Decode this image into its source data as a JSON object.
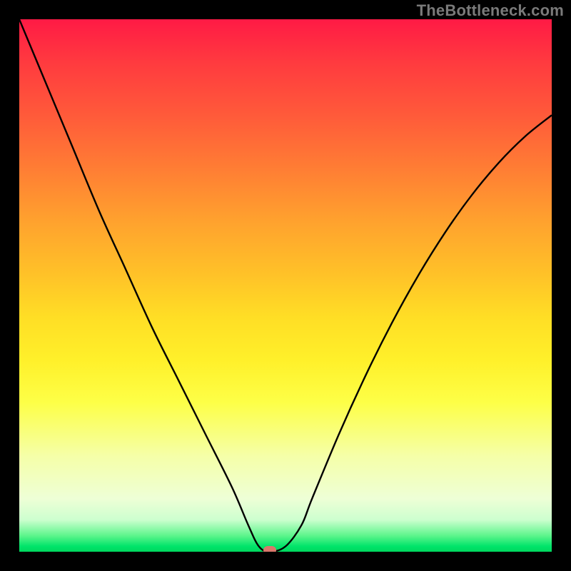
{
  "watermark": "TheBottleneck.com",
  "chart_data": {
    "type": "line",
    "title": "",
    "xlabel": "",
    "ylabel": "",
    "xlim": [
      0,
      100
    ],
    "ylim": [
      0,
      100
    ],
    "series": [
      {
        "name": "bottleneck-curve",
        "x": [
          0,
          5,
          10,
          15,
          20,
          25,
          30,
          35,
          40,
          43,
          45,
          47,
          50,
          53,
          55,
          60,
          65,
          70,
          75,
          80,
          85,
          90,
          95,
          100
        ],
        "values": [
          100,
          88,
          76,
          64,
          53,
          42,
          32,
          22,
          12,
          5,
          1,
          0,
          1,
          5,
          10,
          22,
          33,
          43,
          52,
          60,
          67,
          73,
          78,
          82
        ]
      }
    ],
    "trough": {
      "x": 47,
      "y": 0
    },
    "background": {
      "type": "vertical-gradient",
      "stops": [
        {
          "pos": 0.0,
          "color": "#ff1a45"
        },
        {
          "pos": 0.3,
          "color": "#ff7d34"
        },
        {
          "pos": 0.55,
          "color": "#ffde25"
        },
        {
          "pos": 0.8,
          "color": "#f5ffa8"
        },
        {
          "pos": 0.97,
          "color": "#5cf58b"
        },
        {
          "pos": 1.0,
          "color": "#00d85e"
        }
      ]
    }
  }
}
